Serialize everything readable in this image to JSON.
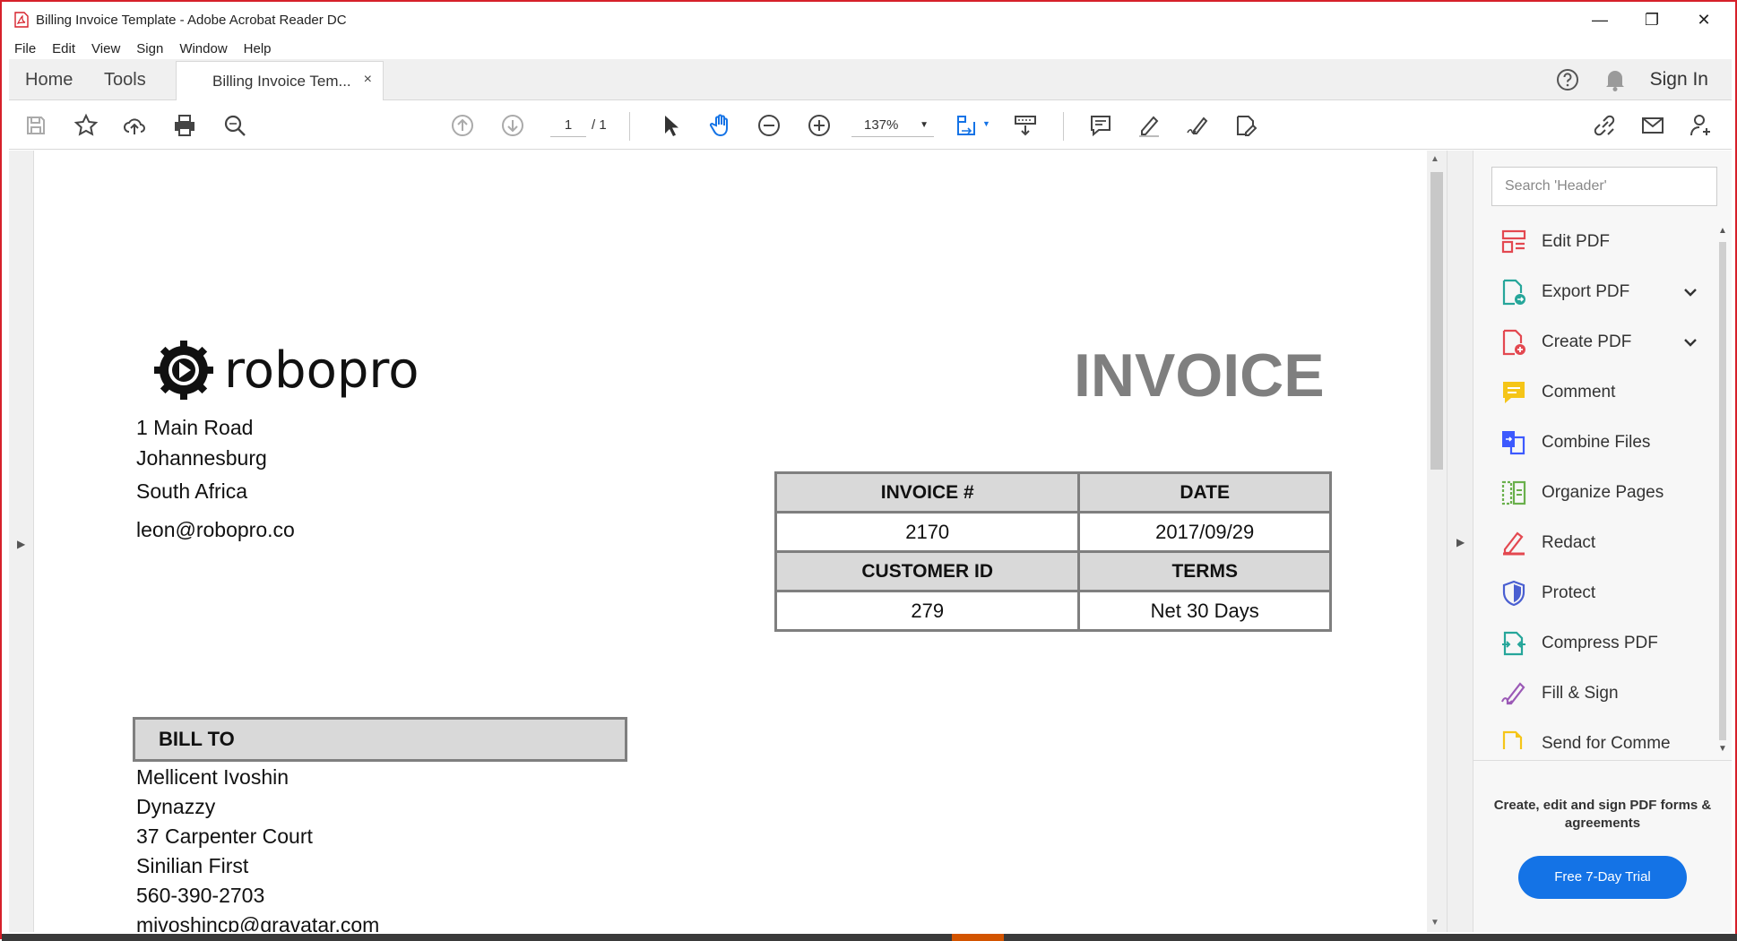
{
  "window": {
    "title": "Billing Invoice Template - Adobe Acrobat Reader DC",
    "minimize": "—",
    "restore": "❐",
    "close": "✕"
  },
  "menu": [
    "File",
    "Edit",
    "View",
    "Sign",
    "Window",
    "Help"
  ],
  "tabs": {
    "home": "Home",
    "tools": "Tools",
    "document": "Billing Invoice Tem...",
    "close": "×",
    "sign_in": "Sign In"
  },
  "toolbar": {
    "page_current": "1",
    "page_total": "/ 1",
    "zoom": "137%"
  },
  "right_pane": {
    "search_placeholder": "Search 'Header'",
    "tools": [
      {
        "label": "Edit PDF",
        "icon": "edit-pdf-icon",
        "color": "#e34850"
      },
      {
        "label": "Export PDF",
        "icon": "export-pdf-icon",
        "color": "#26a69a"
      },
      {
        "label": "Create PDF",
        "icon": "create-pdf-icon",
        "color": "#e34850"
      },
      {
        "label": "Comment",
        "icon": "comment-icon",
        "color": "#f5c518"
      },
      {
        "label": "Combine Files",
        "icon": "combine-files-icon",
        "color": "#3d5afe"
      },
      {
        "label": "Organize Pages",
        "icon": "organize-pages-icon",
        "color": "#6ab04c"
      },
      {
        "label": "Redact",
        "icon": "redact-icon",
        "color": "#e34850"
      },
      {
        "label": "Protect",
        "icon": "protect-icon",
        "color": "#4a5fd1"
      },
      {
        "label": "Compress PDF",
        "icon": "compress-pdf-icon",
        "color": "#26a69a"
      },
      {
        "label": "Fill & Sign",
        "icon": "fill-sign-icon",
        "color": "#9b59b6"
      },
      {
        "label": "Send for Comme",
        "icon": "send-for-comment-icon",
        "color": "#f5c518"
      }
    ],
    "promo_text": "Create, edit and sign PDF forms & agreements",
    "trial_button": "Free 7-Day Trial"
  },
  "invoice": {
    "company": "robopro",
    "address": [
      "1 Main Road",
      "Johannesburg",
      "South Africa",
      "leon@robopro.co"
    ],
    "title": "INVOICE",
    "table": {
      "invoice_no_label": "INVOICE #",
      "date_label": "DATE",
      "invoice_no": "2170",
      "date": "2017/09/29",
      "customer_id_label": "CUSTOMER ID",
      "terms_label": "TERMS",
      "customer_id": "279",
      "terms": "Net 30 Days"
    },
    "bill_to_label": "BILL TO",
    "bill_to": [
      "Mellicent Ivoshin",
      "Dynazzy",
      "37 Carpenter Court",
      "Sinilian First",
      "560-390-2703",
      "mivoshincp@gravatar.com"
    ]
  }
}
